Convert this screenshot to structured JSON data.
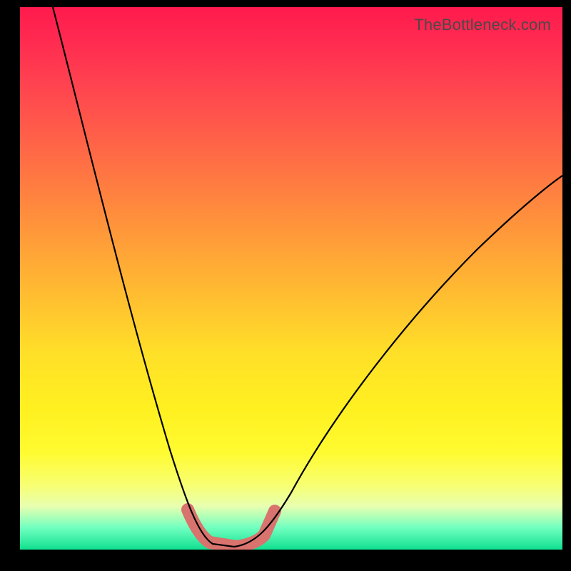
{
  "watermark": "TheBottleneck.com",
  "chart_data": {
    "type": "line",
    "title": "",
    "xlabel": "",
    "ylabel": "",
    "xlim": [
      0,
      100
    ],
    "ylim": [
      0,
      100
    ],
    "grid": false,
    "legend": false,
    "background_gradient": {
      "top": "#ff1a4d",
      "middle": "#ffe028",
      "bottom": "#10e090"
    },
    "series": [
      {
        "name": "left-descent",
        "description": "steep descending curve from top-left toward the trough",
        "x": [
          6,
          10,
          14,
          18,
          22,
          26,
          29,
          31,
          33,
          35
        ],
        "y": [
          100,
          85,
          68,
          52,
          37,
          23,
          12,
          6,
          3,
          1
        ]
      },
      {
        "name": "trough",
        "description": "flat minimum segment highlighted with thick stroke",
        "x": [
          31,
          35,
          40,
          44,
          47
        ],
        "y": [
          6,
          1,
          0,
          1,
          6
        ]
      },
      {
        "name": "right-ascent",
        "description": "rising curve from the trough toward the upper right",
        "x": [
          44,
          48,
          55,
          63,
          72,
          82,
          92,
          100
        ],
        "y": [
          1,
          6,
          14,
          24,
          36,
          48,
          58,
          66
        ]
      }
    ],
    "highlight": {
      "color": "#d9736d",
      "applies_to": "trough",
      "x_range": [
        31,
        47
      ]
    }
  }
}
